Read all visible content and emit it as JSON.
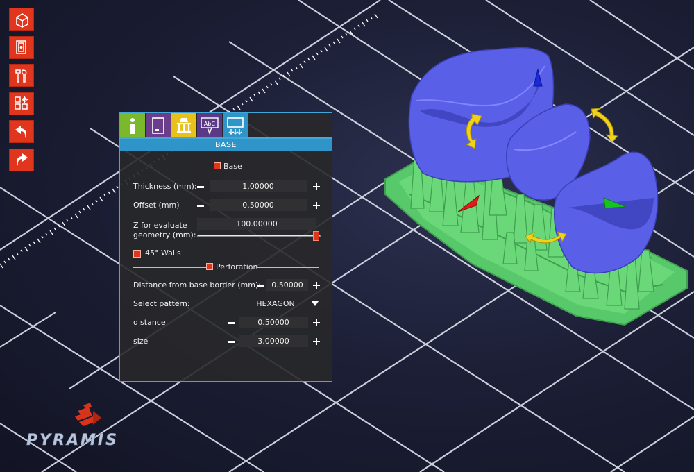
{
  "toolbar": {
    "buttons": [
      {
        "icon": "cube-house-icon"
      },
      {
        "icon": "open-file-icon"
      },
      {
        "icon": "tools-icon"
      },
      {
        "icon": "settings-grid-icon"
      },
      {
        "icon": "undo-icon"
      },
      {
        "icon": "redo-icon"
      }
    ]
  },
  "panel": {
    "tabs": [
      {
        "icon": "info-icon",
        "color": "#7ab82e"
      },
      {
        "icon": "document-icon",
        "color": "#6a3e8a"
      },
      {
        "icon": "supports-icon",
        "color": "#e8c21a"
      },
      {
        "icon": "label-abc-icon",
        "color": "#5a3a86"
      },
      {
        "icon": "base-icon",
        "color": "#2f95c8"
      }
    ],
    "header": "BASE",
    "base_section": "Base",
    "thickness": {
      "label": "Thickness (mm):",
      "value": "1.00000"
    },
    "offset": {
      "label": "Offset (mm)",
      "value": "0.50000"
    },
    "z_eval": {
      "label_line1": "Z for evaluate",
      "label_line2": "geometry (mm):",
      "value": "100.00000",
      "slider_level": 1.0
    },
    "walls": {
      "label": "45° Walls",
      "checked": true
    },
    "perforation_section": "Perforation",
    "distance_border": {
      "label": "Distance from base border (mm):",
      "value": "0.50000"
    },
    "pattern": {
      "label": "Select pattern:",
      "value": "HEXAGON"
    },
    "distance": {
      "label": "distance",
      "value": "0.50000"
    },
    "size": {
      "label": "size",
      "value": "3.00000"
    }
  },
  "logo": {
    "text": "PYRAMIS"
  },
  "colors": {
    "accent": "#e0361e",
    "panel_blue": "#2f95c8",
    "model_blue": "#5a5fe8",
    "support_green": "#5ed06a"
  }
}
